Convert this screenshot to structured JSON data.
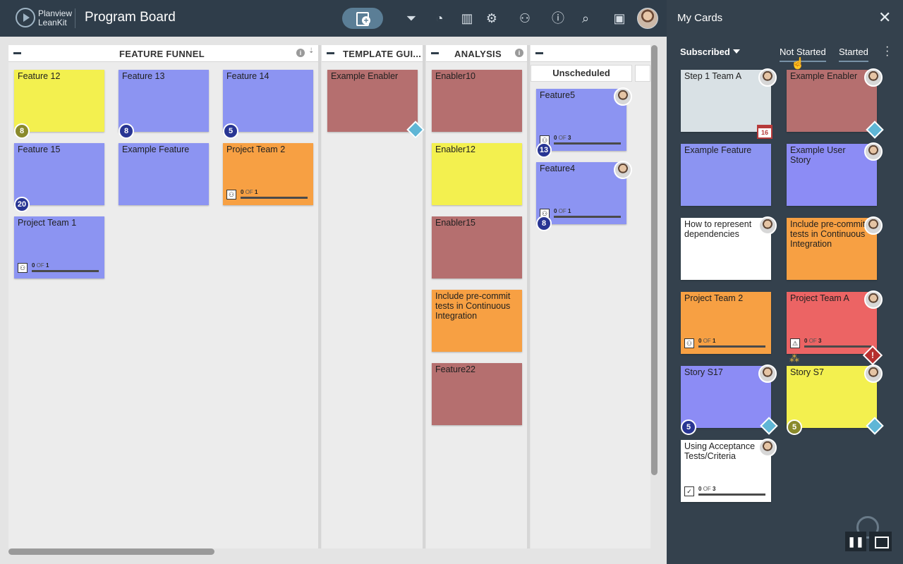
{
  "topbar": {
    "brand_line1": "Planview",
    "brand_line2": "LeanKit",
    "board_title": "Program Board",
    "icons": [
      "add-card-icon",
      "filter-icon",
      "timeline-icon",
      "analytics-icon",
      "settings-icon",
      "add-user-icon",
      "info-icon",
      "search-icon",
      "my-cards-icon",
      "user-avatar"
    ]
  },
  "lanes": [
    {
      "title": "FEATURE FUNNEL"
    },
    {
      "title": "TEMPLATE GUI..."
    },
    {
      "title": "ANALYSIS"
    },
    {
      "title": ""
    }
  ],
  "sublanes": {
    "unscheduled": "Unscheduled"
  },
  "cards": [
    {
      "title": "Feature 12",
      "color": "#f3f04f",
      "badge": "8",
      "badge_color": "#8a8a2c"
    },
    {
      "title": "Feature 13",
      "color": "#8c94f2",
      "badge": "8",
      "badge_color": "#283593"
    },
    {
      "title": "Feature 14",
      "color": "#8c94f2",
      "badge": "5",
      "badge_color": "#283593"
    },
    {
      "title": "Feature 15",
      "color": "#8c94f2",
      "badge": "20",
      "badge_color": "#283593"
    },
    {
      "title": "Example Feature",
      "color": "#8c94f2"
    },
    {
      "title": "Project Team 2",
      "color": "#f7a043",
      "progress": {
        "done": "0",
        "of": "OF",
        "total": "1"
      }
    },
    {
      "title": "Project Team 1",
      "color": "#8c94f2",
      "progress": {
        "done": "0",
        "of": "OF",
        "total": "1"
      }
    },
    {
      "title": "Example Enabler",
      "color": "#b56f6f"
    },
    {
      "title": "Enabler10",
      "color": "#b56f6f"
    },
    {
      "title": "Enabler12",
      "color": "#f3f04f"
    },
    {
      "title": "Enabler15",
      "color": "#b56f6f"
    },
    {
      "title": "Include pre-commit tests in Continuous Integration",
      "color": "#f7a043"
    },
    {
      "title": "Feature22",
      "color": "#b56f6f"
    },
    {
      "title": "Feature5",
      "color": "#8c94f2",
      "badge": "13",
      "badge_color": "#283593",
      "progress": {
        "done": "0",
        "of": "OF",
        "total": "3"
      }
    },
    {
      "title": "Feature4",
      "color": "#8c94f2",
      "badge": "8",
      "badge_color": "#283593",
      "progress": {
        "done": "0",
        "of": "OF",
        "total": "1"
      }
    }
  ],
  "panel": {
    "title": "My Cards",
    "filter": "Subscribed",
    "tabs": [
      "Not Started",
      "Started"
    ],
    "cards": [
      {
        "title": "Step 1 Team A",
        "color": "#d9e1e5",
        "date": "16"
      },
      {
        "title": "Example Enabler",
        "color": "#b56f6f"
      },
      {
        "title": "Example Feature",
        "color": "#8c94f2"
      },
      {
        "title": "Example User Story",
        "color": "#8c8cf5"
      },
      {
        "title": "How to represent dependencies",
        "color": "#ffffff"
      },
      {
        "title": "Include pre-commit tests in Continuous Integration",
        "color": "#f7a043"
      },
      {
        "title": "Project Team 2",
        "color": "#f7a043",
        "progress": {
          "done": "0",
          "of": "OF",
          "total": "1"
        }
      },
      {
        "title": "Project Team A",
        "color": "#ec6464",
        "progress": {
          "done": "0",
          "of": "OF",
          "total": "3"
        }
      },
      {
        "title": "Story S17",
        "color": "#8c8cf5",
        "badge": "5",
        "badge_color": "#283593"
      },
      {
        "title": "Story S7",
        "color": "#f3f04f",
        "badge": "5",
        "badge_color": "#8a8a2c"
      },
      {
        "title": "Using Acceptance Tests/Criteria",
        "color": "#ffffff",
        "progress": {
          "done": "0",
          "of": "OF",
          "total": "3"
        }
      }
    ]
  }
}
